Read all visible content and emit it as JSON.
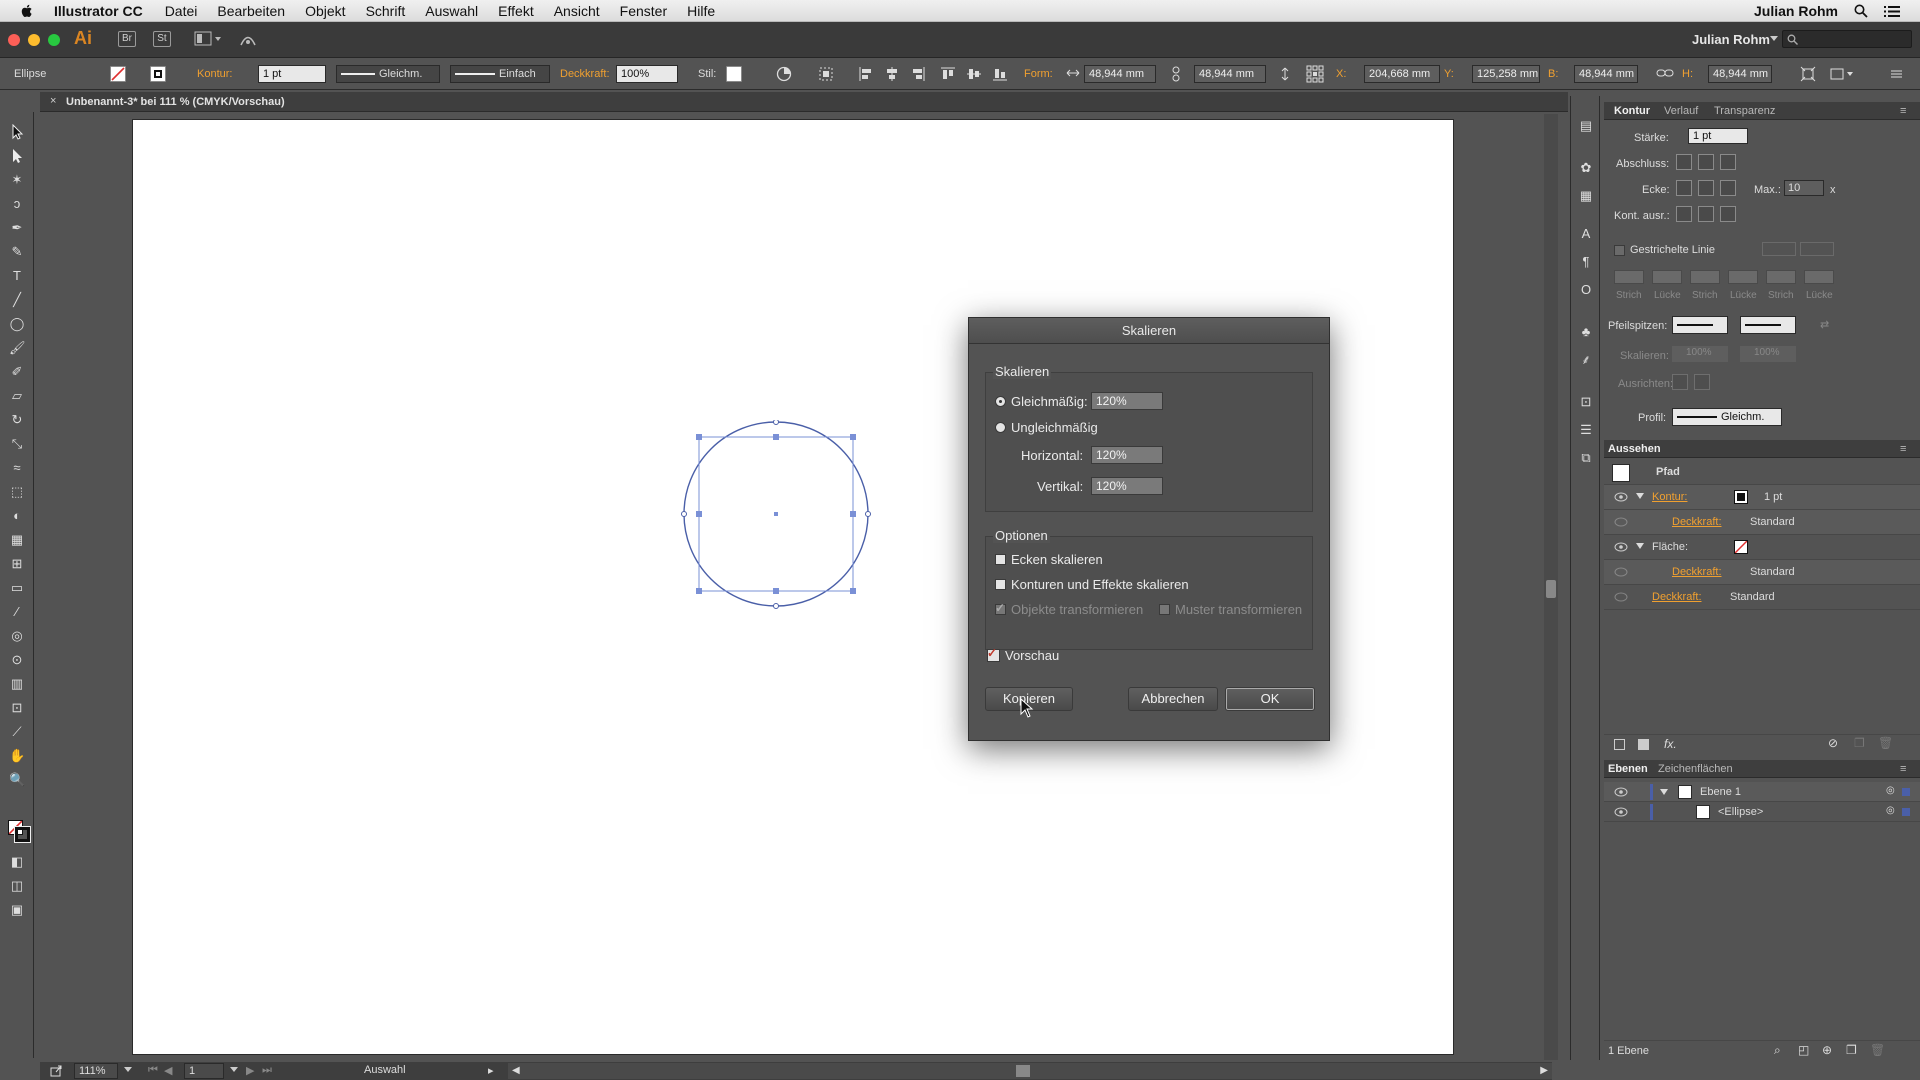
{
  "menubar": {
    "app_name": "Illustrator CC",
    "items": [
      "Datei",
      "Bearbeiten",
      "Objekt",
      "Schrift",
      "Auswahl",
      "Effekt",
      "Ansicht",
      "Fenster",
      "Hilfe"
    ],
    "user": "Julian Rohm"
  },
  "appbar": {
    "logo": "Ai",
    "br": "Br",
    "st": "St",
    "username": "Julian Rohm"
  },
  "control_bar": {
    "object_type": "Ellipse",
    "kontur_label": "Kontur:",
    "kontur_value": "1 pt",
    "profile": "Gleichm.",
    "brush": "Einfach",
    "opacity_label": "Deckkraft:",
    "opacity_value": "100%",
    "style_label": "Stil:",
    "form_label": "Form:",
    "form_w": "48,944 mm",
    "form_h": "48,944 mm",
    "x_label": "X:",
    "x_value": "204,668 mm",
    "y_label": "Y:",
    "y_value": "125,258 mm",
    "b_label": "B:",
    "b_value": "48,944 mm",
    "h_label": "H:",
    "h_value": "48,944 mm"
  },
  "document": {
    "close": "×",
    "tab_title": "Unbenannt-3* bei 111 % (CMYK/Vorschau)"
  },
  "status_bar": {
    "zoom": "111%",
    "artboard": "1",
    "tool": "Auswahl"
  },
  "panels": {
    "stroke_tabs": [
      "Kontur",
      "Verlauf",
      "Transparenz"
    ],
    "staerke_label": "Stärke:",
    "staerke_value": "1 pt",
    "abschluss_label": "Abschluss:",
    "ecke_label": "Ecke:",
    "max_label": "Max.:",
    "max_value": "10",
    "max_unit": "x",
    "kont_ausr_label": "Kont. ausr.:",
    "dashed_label": "Gestrichelte Linie",
    "dash_labels": [
      "Strich",
      "Lücke",
      "Strich",
      "Lücke",
      "Strich",
      "Lücke"
    ],
    "pfeilspitzen_label": "Pfeilspitzen:",
    "skalieren_label": "Skalieren:",
    "scale_values": [
      "100%",
      "100%"
    ],
    "ausrichten_label": "Ausrichten:",
    "profil_label": "Profil:",
    "profil_value": "Gleichm.",
    "appearance_tab": "Aussehen",
    "appearance": {
      "path": "Pfad",
      "kontur_label": "Kontur:",
      "kontur_value": "1 pt",
      "deckkraft_label": "Deckkraft:",
      "standard": "Standard",
      "flaeche_label": "Fläche:",
      "fx": "fx."
    },
    "layers_tabs": [
      "Ebenen",
      "Zeichenflächen"
    ],
    "layers": [
      "Ebene 1",
      "<Ellipse>"
    ],
    "layers_count": "1 Ebene"
  },
  "dialog": {
    "title": "Skalieren",
    "group_scale": "Skalieren",
    "uniform_label": "Gleichmäßig:",
    "uniform_value": "120%",
    "nonuniform_label": "Ungleichmäßig",
    "horizontal_label": "Horizontal:",
    "horizontal_value": "120%",
    "vertical_label": "Vertikal:",
    "vertical_value": "120%",
    "group_options": "Optionen",
    "opt_corners": "Ecken skalieren",
    "opt_strokes": "Konturen und Effekte skalieren",
    "opt_objects": "Objekte transformieren",
    "opt_patterns": "Muster transformieren",
    "preview_label": "Vorschau",
    "btn_copy": "Kopieren",
    "btn_cancel": "Abbrechen",
    "btn_ok": "OK"
  },
  "colors": {
    "accent_orange": "#f0a030",
    "selection_blue": "#4a5fa8",
    "bg": "#535353"
  }
}
